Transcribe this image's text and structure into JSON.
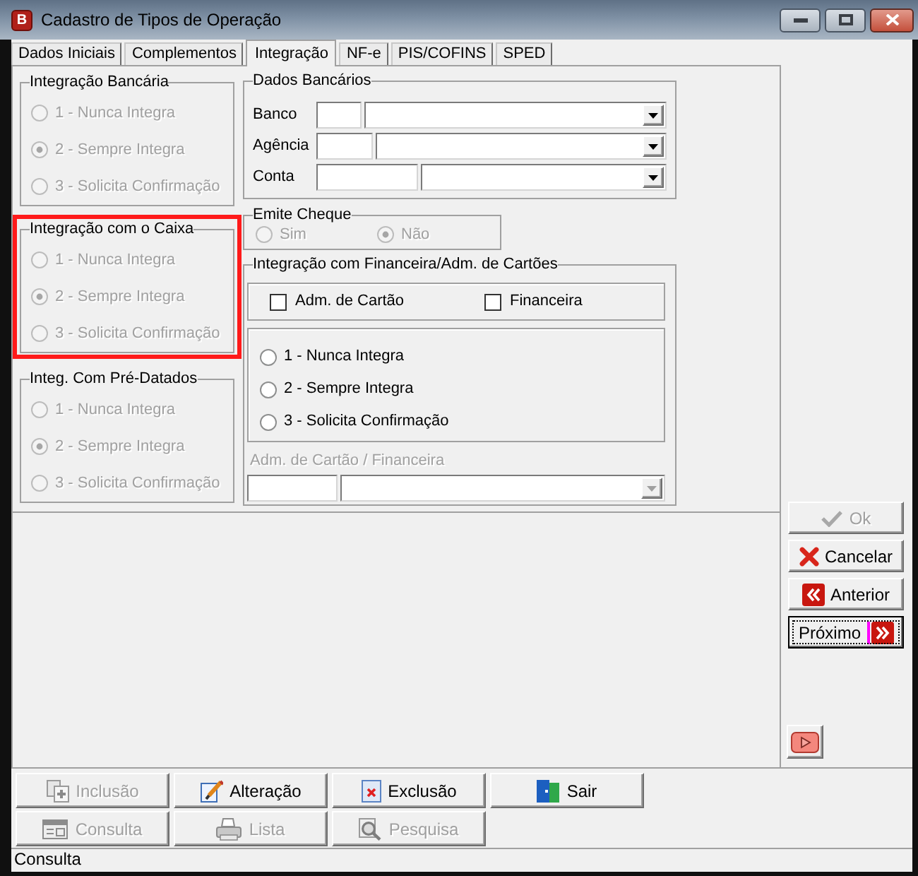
{
  "window": {
    "logo": "B",
    "title": "Cadastro de Tipos de Operação"
  },
  "tabs": [
    {
      "label": "Dados Iniciais",
      "selected": false
    },
    {
      "label": "Complementos",
      "selected": false
    },
    {
      "label": "Integração",
      "selected": true
    },
    {
      "label": "NF-e",
      "selected": false
    },
    {
      "label": "PIS/COFINS",
      "selected": false
    },
    {
      "label": "SPED",
      "selected": false
    }
  ],
  "left_groups": [
    {
      "title": "Integração Bancária",
      "highlighted": false,
      "disabled": true,
      "options": [
        {
          "label": "1 - Nunca Integra",
          "selected": false
        },
        {
          "label": "2 - Sempre Integra",
          "selected": true
        },
        {
          "label": "3 - Solicita Confirmação",
          "selected": false
        }
      ]
    },
    {
      "title": "Integração com o Caixa",
      "highlighted": true,
      "disabled": true,
      "options": [
        {
          "label": "1 - Nunca Integra",
          "selected": false
        },
        {
          "label": "2 - Sempre Integra",
          "selected": true
        },
        {
          "label": "3 - Solicita Confirmação",
          "selected": false
        }
      ]
    },
    {
      "title": "Integ. Com Pré-Datados",
      "highlighted": false,
      "disabled": true,
      "options": [
        {
          "label": "1 - Nunca Integra",
          "selected": false
        },
        {
          "label": "2 - Sempre Integra",
          "selected": true
        },
        {
          "label": "3 - Solicita Confirmação",
          "selected": false
        }
      ]
    }
  ],
  "bank_data": {
    "title": "Dados Bancários",
    "rows": [
      {
        "label": "Banco"
      },
      {
        "label": "Agência"
      },
      {
        "label": "Conta"
      }
    ]
  },
  "emite_cheque": {
    "title": "Emite Cheque",
    "disabled": true,
    "options": [
      {
        "label": "Sim",
        "selected": false
      },
      {
        "label": "Não",
        "selected": true
      }
    ]
  },
  "card_integration": {
    "title": "Integração com Financeira/Adm. de Cartões",
    "checkboxes": [
      {
        "label": "Adm. de Cartão",
        "checked": false
      },
      {
        "label": "Financeira",
        "checked": false
      }
    ],
    "options": [
      {
        "label": "1 - Nunca Integra",
        "selected": false
      },
      {
        "label": "2 - Sempre Integra",
        "selected": false
      },
      {
        "label": "3 - Solicita Confirmação",
        "selected": false
      }
    ],
    "lookup": {
      "label": "Adm. de Cartão / Financeira",
      "disabled": true
    }
  },
  "side_buttons": [
    {
      "kind": "confirm",
      "label": "Ok",
      "disabled": true,
      "focused": false
    },
    {
      "kind": "cancel",
      "label": "Cancelar",
      "disabled": false,
      "focused": false
    },
    {
      "kind": "previous",
      "label": "Anterior",
      "disabled": false,
      "focused": false
    },
    {
      "kind": "next",
      "label": "Próximo",
      "disabled": false,
      "focused": true
    }
  ],
  "toolbar": [
    {
      "kind": "add",
      "label": "Inclusão",
      "disabled": true
    },
    {
      "kind": "edit",
      "label": "Alteração",
      "disabled": false
    },
    {
      "kind": "delete",
      "label": "Exclusão",
      "disabled": false
    },
    {
      "kind": "exit",
      "label": "Sair",
      "disabled": false
    },
    {
      "kind": "view",
      "label": "Consulta",
      "disabled": true
    },
    {
      "kind": "print",
      "label": "Lista",
      "disabled": true
    },
    {
      "kind": "search",
      "label": "Pesquisa",
      "disabled": true
    }
  ],
  "status_bar": {
    "text": "Consulta"
  }
}
